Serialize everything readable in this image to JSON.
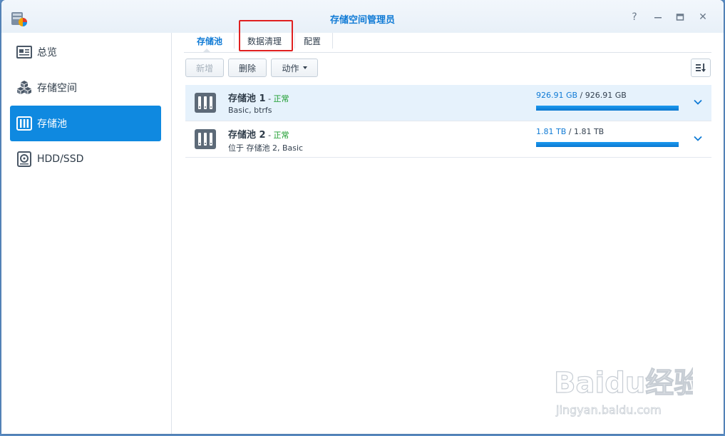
{
  "window": {
    "title": "存储空间管理员",
    "controls": [
      "help-icon",
      "minimize-icon",
      "maximize-icon",
      "close-icon"
    ],
    "help_label": "?",
    "close_label": "✕"
  },
  "sidebar": {
    "items": [
      {
        "label": "总览",
        "icon": "overview-icon",
        "active": false
      },
      {
        "label": "存储空间",
        "icon": "volume-cubes-icon",
        "active": false
      },
      {
        "label": "存储池",
        "icon": "storage-pool-icon",
        "active": true
      },
      {
        "label": "HDD/SSD",
        "icon": "hdd-icon",
        "active": false
      }
    ]
  },
  "tabs": [
    {
      "label": "存储池",
      "active": true
    },
    {
      "label": "数据清理",
      "active": false,
      "highlighted": true
    },
    {
      "label": "配置",
      "active": false
    }
  ],
  "toolbar": {
    "new_label": "新增",
    "delete_label": "删除",
    "action_label": "动作"
  },
  "pools": [
    {
      "name": "存储池 1",
      "dash": " - ",
      "status": "正常",
      "description": "Basic, btrfs",
      "used": "926.91 GB",
      "separator": " / ",
      "total": "926.91 GB",
      "usage_fraction": 1.0,
      "selected": true
    },
    {
      "name": "存储池 2",
      "dash": " - ",
      "status": "正常",
      "description": "位于 存储池 2, Basic",
      "used": "1.81 TB",
      "separator": " / ",
      "total": "1.81 TB",
      "usage_fraction": 1.0,
      "selected": false
    }
  ],
  "watermark": {
    "brand": "Baidu经验",
    "url": "jingyan.baidu.com"
  },
  "colors": {
    "accent": "#0f7ad5",
    "status_ok": "#1a9c2c",
    "highlight": "#e02020"
  }
}
